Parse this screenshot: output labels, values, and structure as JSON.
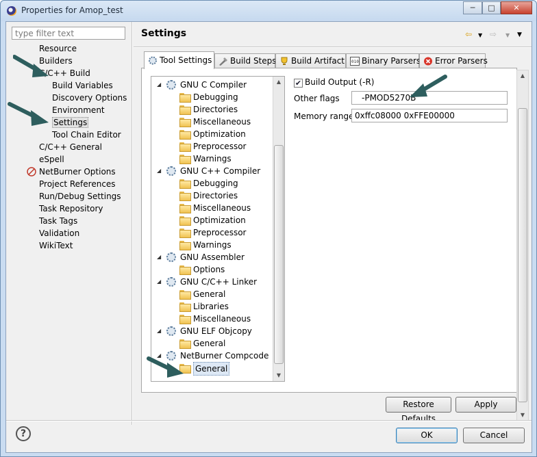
{
  "window": {
    "title": "Properties for Amop_test"
  },
  "filter": {
    "placeholder": "type filter text"
  },
  "nav": {
    "items": [
      {
        "label": "Resource"
      },
      {
        "label": "Builders"
      },
      {
        "label": "C/C++ Build"
      },
      {
        "label": "Build Variables"
      },
      {
        "label": "Discovery Options"
      },
      {
        "label": "Environment"
      },
      {
        "label": "Settings"
      },
      {
        "label": "Tool Chain Editor"
      },
      {
        "label": "C/C++ General"
      },
      {
        "label": "eSpell"
      },
      {
        "label": "NetBurner Options"
      },
      {
        "label": "Project References"
      },
      {
        "label": "Run/Debug Settings"
      },
      {
        "label": "Task Repository"
      },
      {
        "label": "Task Tags"
      },
      {
        "label": "Validation"
      },
      {
        "label": "WikiText"
      }
    ]
  },
  "page": {
    "title": "Settings"
  },
  "tabs": [
    {
      "label": "Tool Settings"
    },
    {
      "label": "Build Steps"
    },
    {
      "label": "Build Artifact"
    },
    {
      "label": "Binary Parsers"
    },
    {
      "label": "Error Parsers"
    }
  ],
  "tree": {
    "groups": [
      {
        "label": "GNU C Compiler",
        "children": [
          "Debugging",
          "Directories",
          "Miscellaneous",
          "Optimization",
          "Preprocessor",
          "Warnings"
        ]
      },
      {
        "label": "GNU C++ Compiler",
        "children": [
          "Debugging",
          "Directories",
          "Miscellaneous",
          "Optimization",
          "Preprocessor",
          "Warnings"
        ]
      },
      {
        "label": "GNU Assembler",
        "children": [
          "Options"
        ]
      },
      {
        "label": "GNU C/C++ Linker",
        "children": [
          "General",
          "Libraries",
          "Miscellaneous"
        ]
      },
      {
        "label": "GNU ELF Objcopy",
        "children": [
          "General"
        ]
      },
      {
        "label": "NetBurner Compcode",
        "children": [
          "General"
        ]
      }
    ]
  },
  "settings": {
    "build_output_label": "Build Output (-R)",
    "build_output_checked": true,
    "other_flags_label": "Other flags",
    "other_flags_value": "-PMOD5270B",
    "memory_range_label": "Memory range",
    "memory_range_value": "0xffc08000 0xFFE00000"
  },
  "buttons": {
    "restore_defaults": "Restore Defaults",
    "apply": "Apply",
    "ok": "OK",
    "cancel": "Cancel",
    "help": "?"
  },
  "colors": {
    "annotation_arrow": "#2e5e5e",
    "selection": "#dde8f5"
  }
}
